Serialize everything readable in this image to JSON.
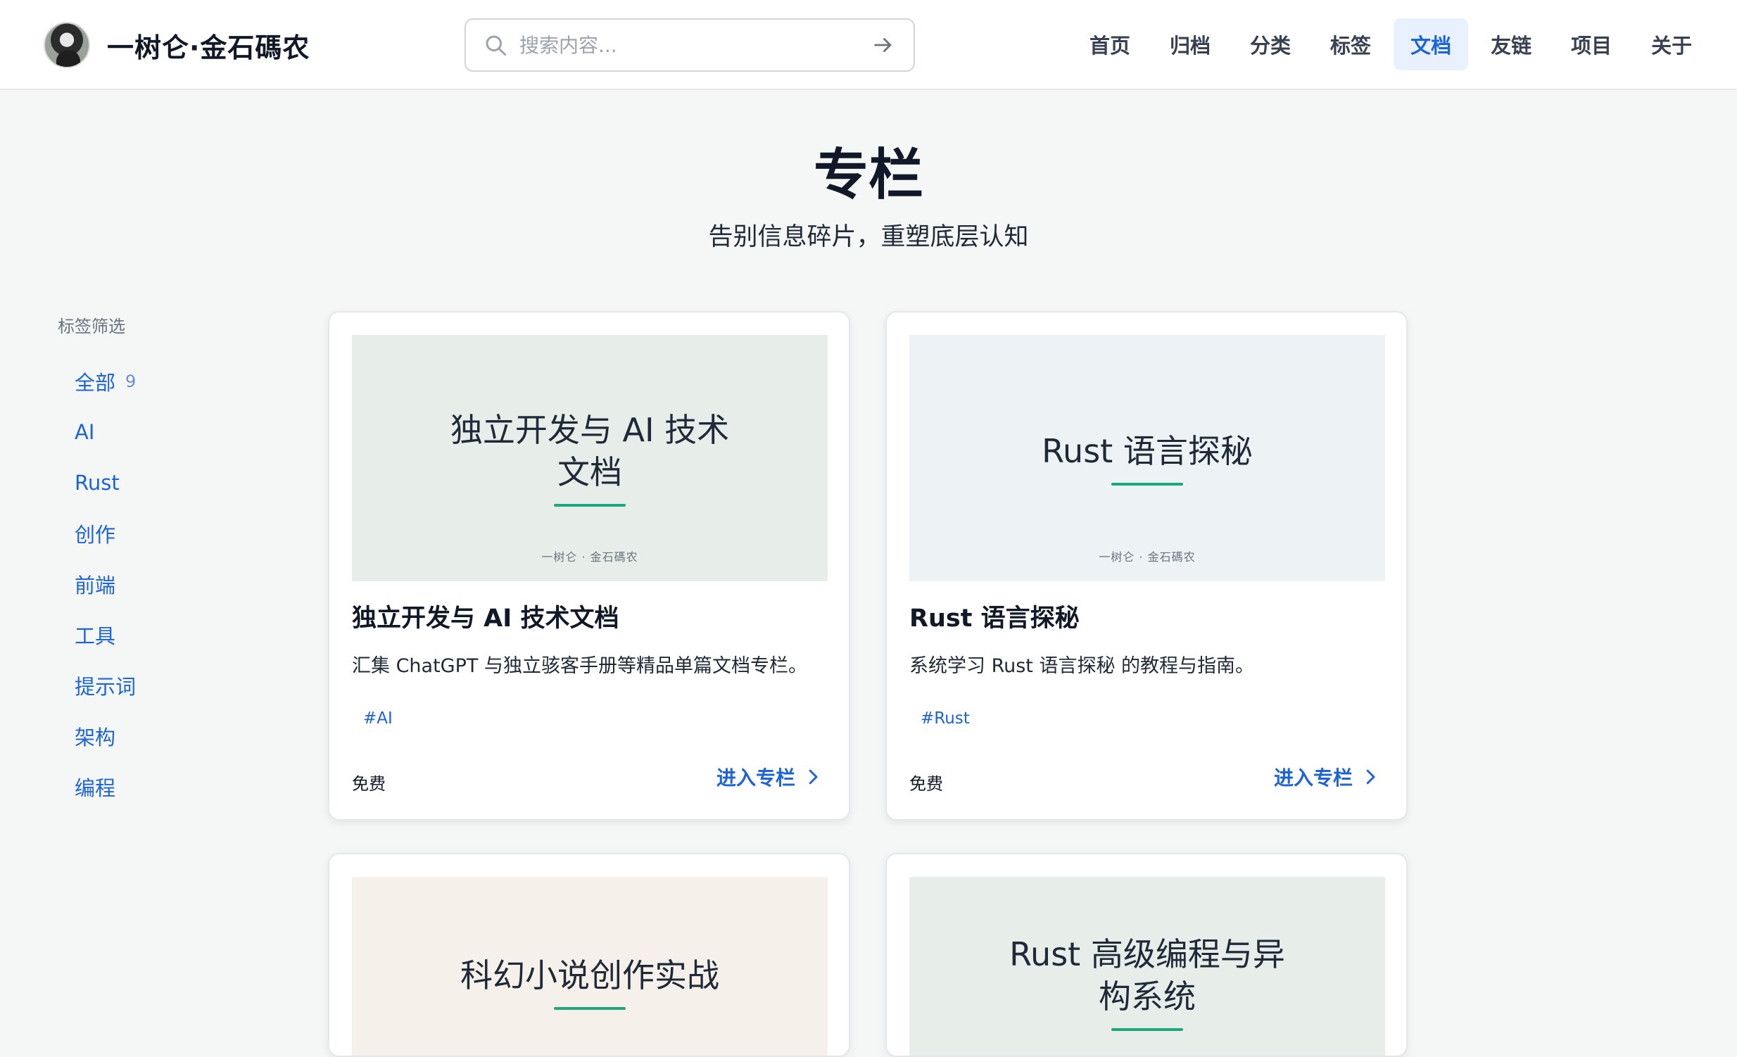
{
  "header": {
    "site_name": "一树仑·金石碼农",
    "search_placeholder": "搜索内容...",
    "nav": [
      "首页",
      "归档",
      "分类",
      "标签",
      "文档",
      "友链",
      "项目",
      "关于"
    ],
    "active_nav": "文档"
  },
  "hero": {
    "title": "专栏",
    "subtitle": "告别信息碎片，重塑底层认知"
  },
  "sidebar": {
    "heading": "标签筛选",
    "filters": [
      {
        "label": "全部",
        "count": "9"
      },
      {
        "label": "AI"
      },
      {
        "label": "Rust"
      },
      {
        "label": "创作"
      },
      {
        "label": "前端"
      },
      {
        "label": "工具"
      },
      {
        "label": "提示词"
      },
      {
        "label": "架构"
      },
      {
        "label": "编程"
      }
    ]
  },
  "cards": [
    {
      "cover_title": "独立开发与 AI 技术文档",
      "cover_author": "一树仑 · 金石碼农",
      "cover_bg": "#e7eee9",
      "title": "独立开发与 AI 技术文档",
      "description": "汇集 ChatGPT 与独立骇客手册等精品单篇文档专栏。",
      "tag": "#AI",
      "price": "免费",
      "action": "进入专栏"
    },
    {
      "cover_title": "Rust 语言探秘",
      "cover_author": "一树仑 · 金石碼农",
      "cover_bg": "#edf2f5",
      "title": "Rust 语言探秘",
      "description": "系统学习 Rust 语言探秘 的教程与指南。",
      "tag": "#Rust",
      "price": "免费",
      "action": "进入专栏"
    },
    {
      "cover_title": "科幻小说创作实战",
      "cover_bg": "#f5f0ea"
    },
    {
      "cover_title": "Rust 高级编程与异构系统",
      "cover_bg": "#e7eee9"
    }
  ],
  "colors": {
    "accent": "#1d64d8",
    "accent_line": "#1ea77d",
    "active_nav_bg": "#e8f1fd"
  }
}
